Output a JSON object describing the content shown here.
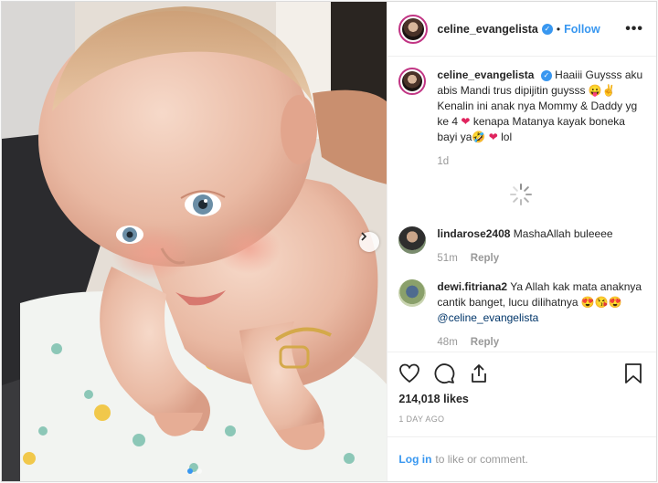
{
  "header": {
    "username": "celine_evangelista",
    "separator": "•",
    "follow_label": "Follow",
    "more_label": "•••"
  },
  "caption": {
    "username": "celine_evangelista",
    "text_part1": "Haaiii Guysss aku abis Mandi trus dipijitin guysss 😛✌ Kenalin ini anak nya Mommy & Daddy yg ke 4 ",
    "heart1": "❤",
    "text_part2": " kenapa Matanya kayak boneka bayi ya🤣 ",
    "heart2": "❤",
    "text_part3": " lol",
    "time": "1d"
  },
  "comments": [
    {
      "username": "lindarose2408",
      "text": "MashaAllah buleeee",
      "time": "51m",
      "reply_label": "Reply"
    },
    {
      "username": "dewi.fitriana2",
      "text": "Ya Allah kak mata anaknya cantik banget, lucu dilihatnya 😍😘😍 ",
      "mention": "@celine_evangelista",
      "time": "48m",
      "reply_label": "Reply"
    }
  ],
  "likes": "214,018 likes",
  "date": "1 DAY AGO",
  "login": {
    "link_label": "Log in",
    "rest": "to like or comment."
  },
  "icons": [
    "heart-icon",
    "comment-icon",
    "share-icon",
    "bookmark-icon",
    "chevron-right-icon",
    "spinner-icon",
    "verified-icon"
  ],
  "colors": {
    "accent": "#3897f0",
    "heart": "#e0245e",
    "muted": "#999999",
    "text": "#262626"
  }
}
